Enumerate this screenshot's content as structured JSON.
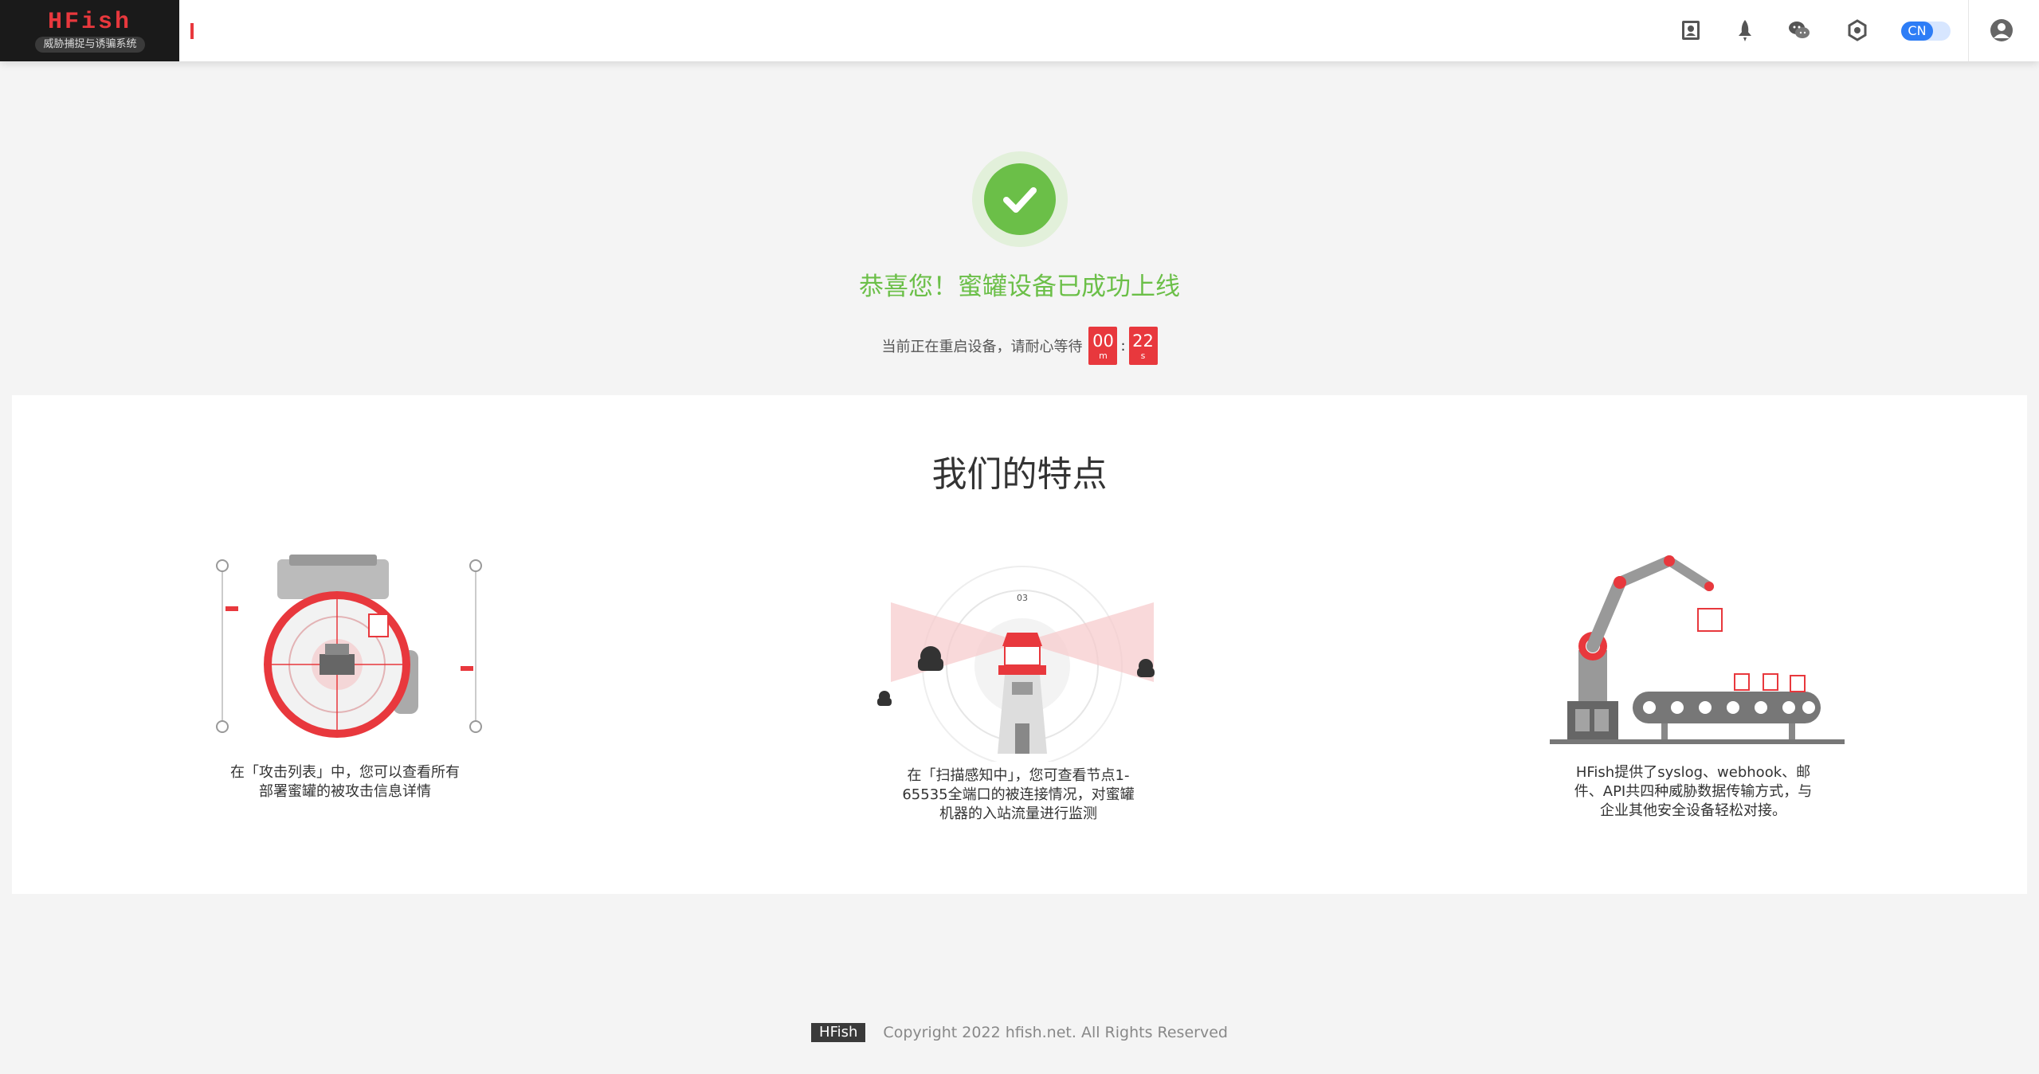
{
  "header": {
    "logo_title": "HFish",
    "logo_subtitle": "威胁捕捉与诱骗系统",
    "lang_label": "CN",
    "icons": [
      "document-icon",
      "rocket-icon",
      "wechat-icon",
      "hexagon-icon",
      "avatar-icon"
    ]
  },
  "success": {
    "title": "恭喜您！蜜罐设备已成功上线",
    "status_text": "当前正在重启设备，请耐心等待",
    "minutes": "00",
    "minutes_unit": "m",
    "seconds": "22",
    "seconds_unit": "s"
  },
  "features": {
    "title": "我们的特点",
    "items": [
      {
        "text_lines": [
          "在「攻击列表」中，您可以查看所有",
          "部署蜜罐的被攻击信息详情"
        ],
        "icon": "target-scope-illustration"
      },
      {
        "text_lines": [
          "在「扫描感知中」，您可查看节点1-",
          "65535全端口的被连接情况，对蜜罐",
          "机器的入站流量进行监测"
        ],
        "icon": "lighthouse-illustration"
      },
      {
        "text_lines": [
          "HFish提供了syslog、webhook、邮",
          "件、API共四种威胁数据传输方式，与",
          "企业其他安全设备轻松对接。"
        ],
        "icon": "robot-arm-illustration"
      }
    ]
  },
  "footer": {
    "badge": "HFish",
    "copyright": "Copyright 2022 hfish.net. All Rights Reserved"
  },
  "colors": {
    "brand_red": "#e8383d",
    "success_green": "#6bbf48",
    "toggle_blue": "#2d7df6",
    "logo_bg": "#1a1a1a"
  }
}
